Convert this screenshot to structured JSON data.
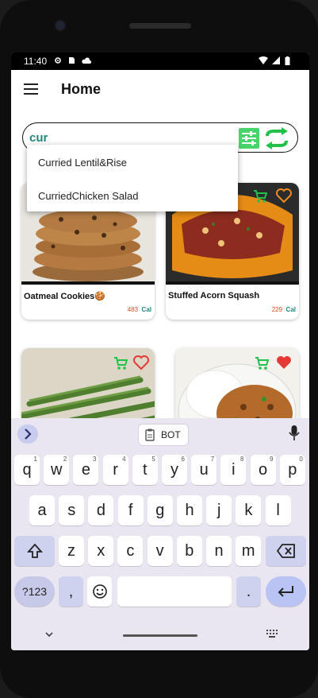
{
  "status_bar": {
    "time": "11:40"
  },
  "app_bar": {
    "title": "Home"
  },
  "search": {
    "value": "cur",
    "placeholder": ""
  },
  "suggestions": [
    "Curried Lentil&Rise",
    "CurriedChicken Salad"
  ],
  "cards": [
    {
      "name": "Oatmeal Cookies🍪",
      "calories": "483",
      "unit": "Cal",
      "favorite": false
    },
    {
      "name": "Stuffed Acorn Squash",
      "calories": "229",
      "unit": "Cal",
      "favorite": false
    },
    {
      "name": "",
      "calories": "",
      "unit": "",
      "favorite": false
    },
    {
      "name": "",
      "calories": "",
      "unit": "",
      "favorite": true
    }
  ],
  "keyboard": {
    "clipboard_chip": "BOT",
    "row1": [
      {
        "k": "q",
        "h": "1"
      },
      {
        "k": "w",
        "h": "2"
      },
      {
        "k": "e",
        "h": "3"
      },
      {
        "k": "r",
        "h": "4"
      },
      {
        "k": "t",
        "h": "5"
      },
      {
        "k": "y",
        "h": "6"
      },
      {
        "k": "u",
        "h": "7"
      },
      {
        "k": "i",
        "h": "8"
      },
      {
        "k": "o",
        "h": "9"
      },
      {
        "k": "p",
        "h": "0"
      }
    ],
    "row2": [
      "a",
      "s",
      "d",
      "f",
      "g",
      "h",
      "j",
      "k",
      "l"
    ],
    "row3": [
      "z",
      "x",
      "c",
      "v",
      "b",
      "n",
      "m"
    ],
    "symbols_key": "?123",
    "comma_key": ",",
    "period_key": "."
  },
  "colors": {
    "accent": "#1d8a7c",
    "filter_green": "#49d46b",
    "calorie_orange": "#e0501f",
    "heart_red": "#e53935"
  }
}
